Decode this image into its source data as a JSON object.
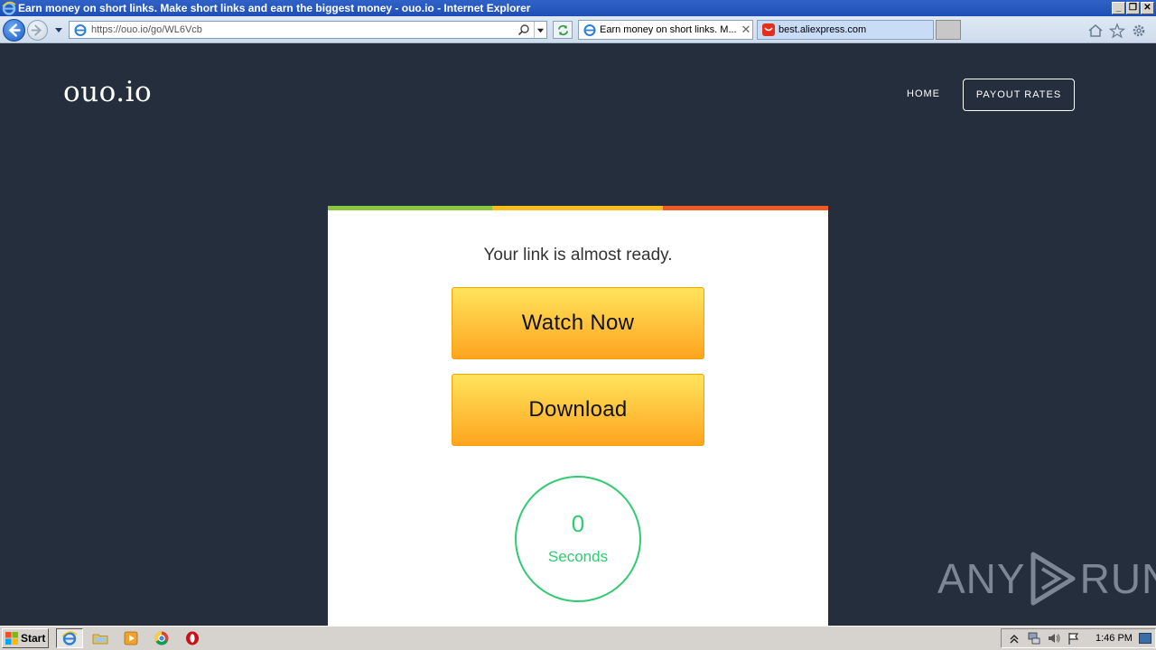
{
  "window": {
    "title": "Earn money on short links. Make short links and earn the biggest money - ouo.io - Internet Explorer",
    "controls": [
      "_",
      "❐",
      "✕"
    ]
  },
  "browser": {
    "url": "https://ouo.io/go/WL6Vcb",
    "tabs": [
      {
        "label": "Earn money on short links. M...",
        "active": true,
        "close": "✕"
      },
      {
        "label": "best.aliexpress.com",
        "active": false
      }
    ]
  },
  "site": {
    "logo": "ouo.io",
    "nav": {
      "home": "HOME",
      "payout": "PAYOUT RATES"
    }
  },
  "card": {
    "title": "Your link is almost ready.",
    "watch_label": "Watch Now",
    "download_label": "Download",
    "timer_value": "0",
    "timer_unit": "Seconds",
    "bar_colors": [
      "#8cc63f",
      "#fbbd1a",
      "#f15a24"
    ]
  },
  "watermark": {
    "left": "ANY",
    "right": "RUN"
  },
  "taskbar": {
    "start_label": "Start",
    "clock": "1:46 PM"
  },
  "colors": {
    "page_bg": "#242e3c",
    "button_top": "#ffe45c",
    "button_bottom": "#ffa41f",
    "timer": "#2ecc71"
  }
}
